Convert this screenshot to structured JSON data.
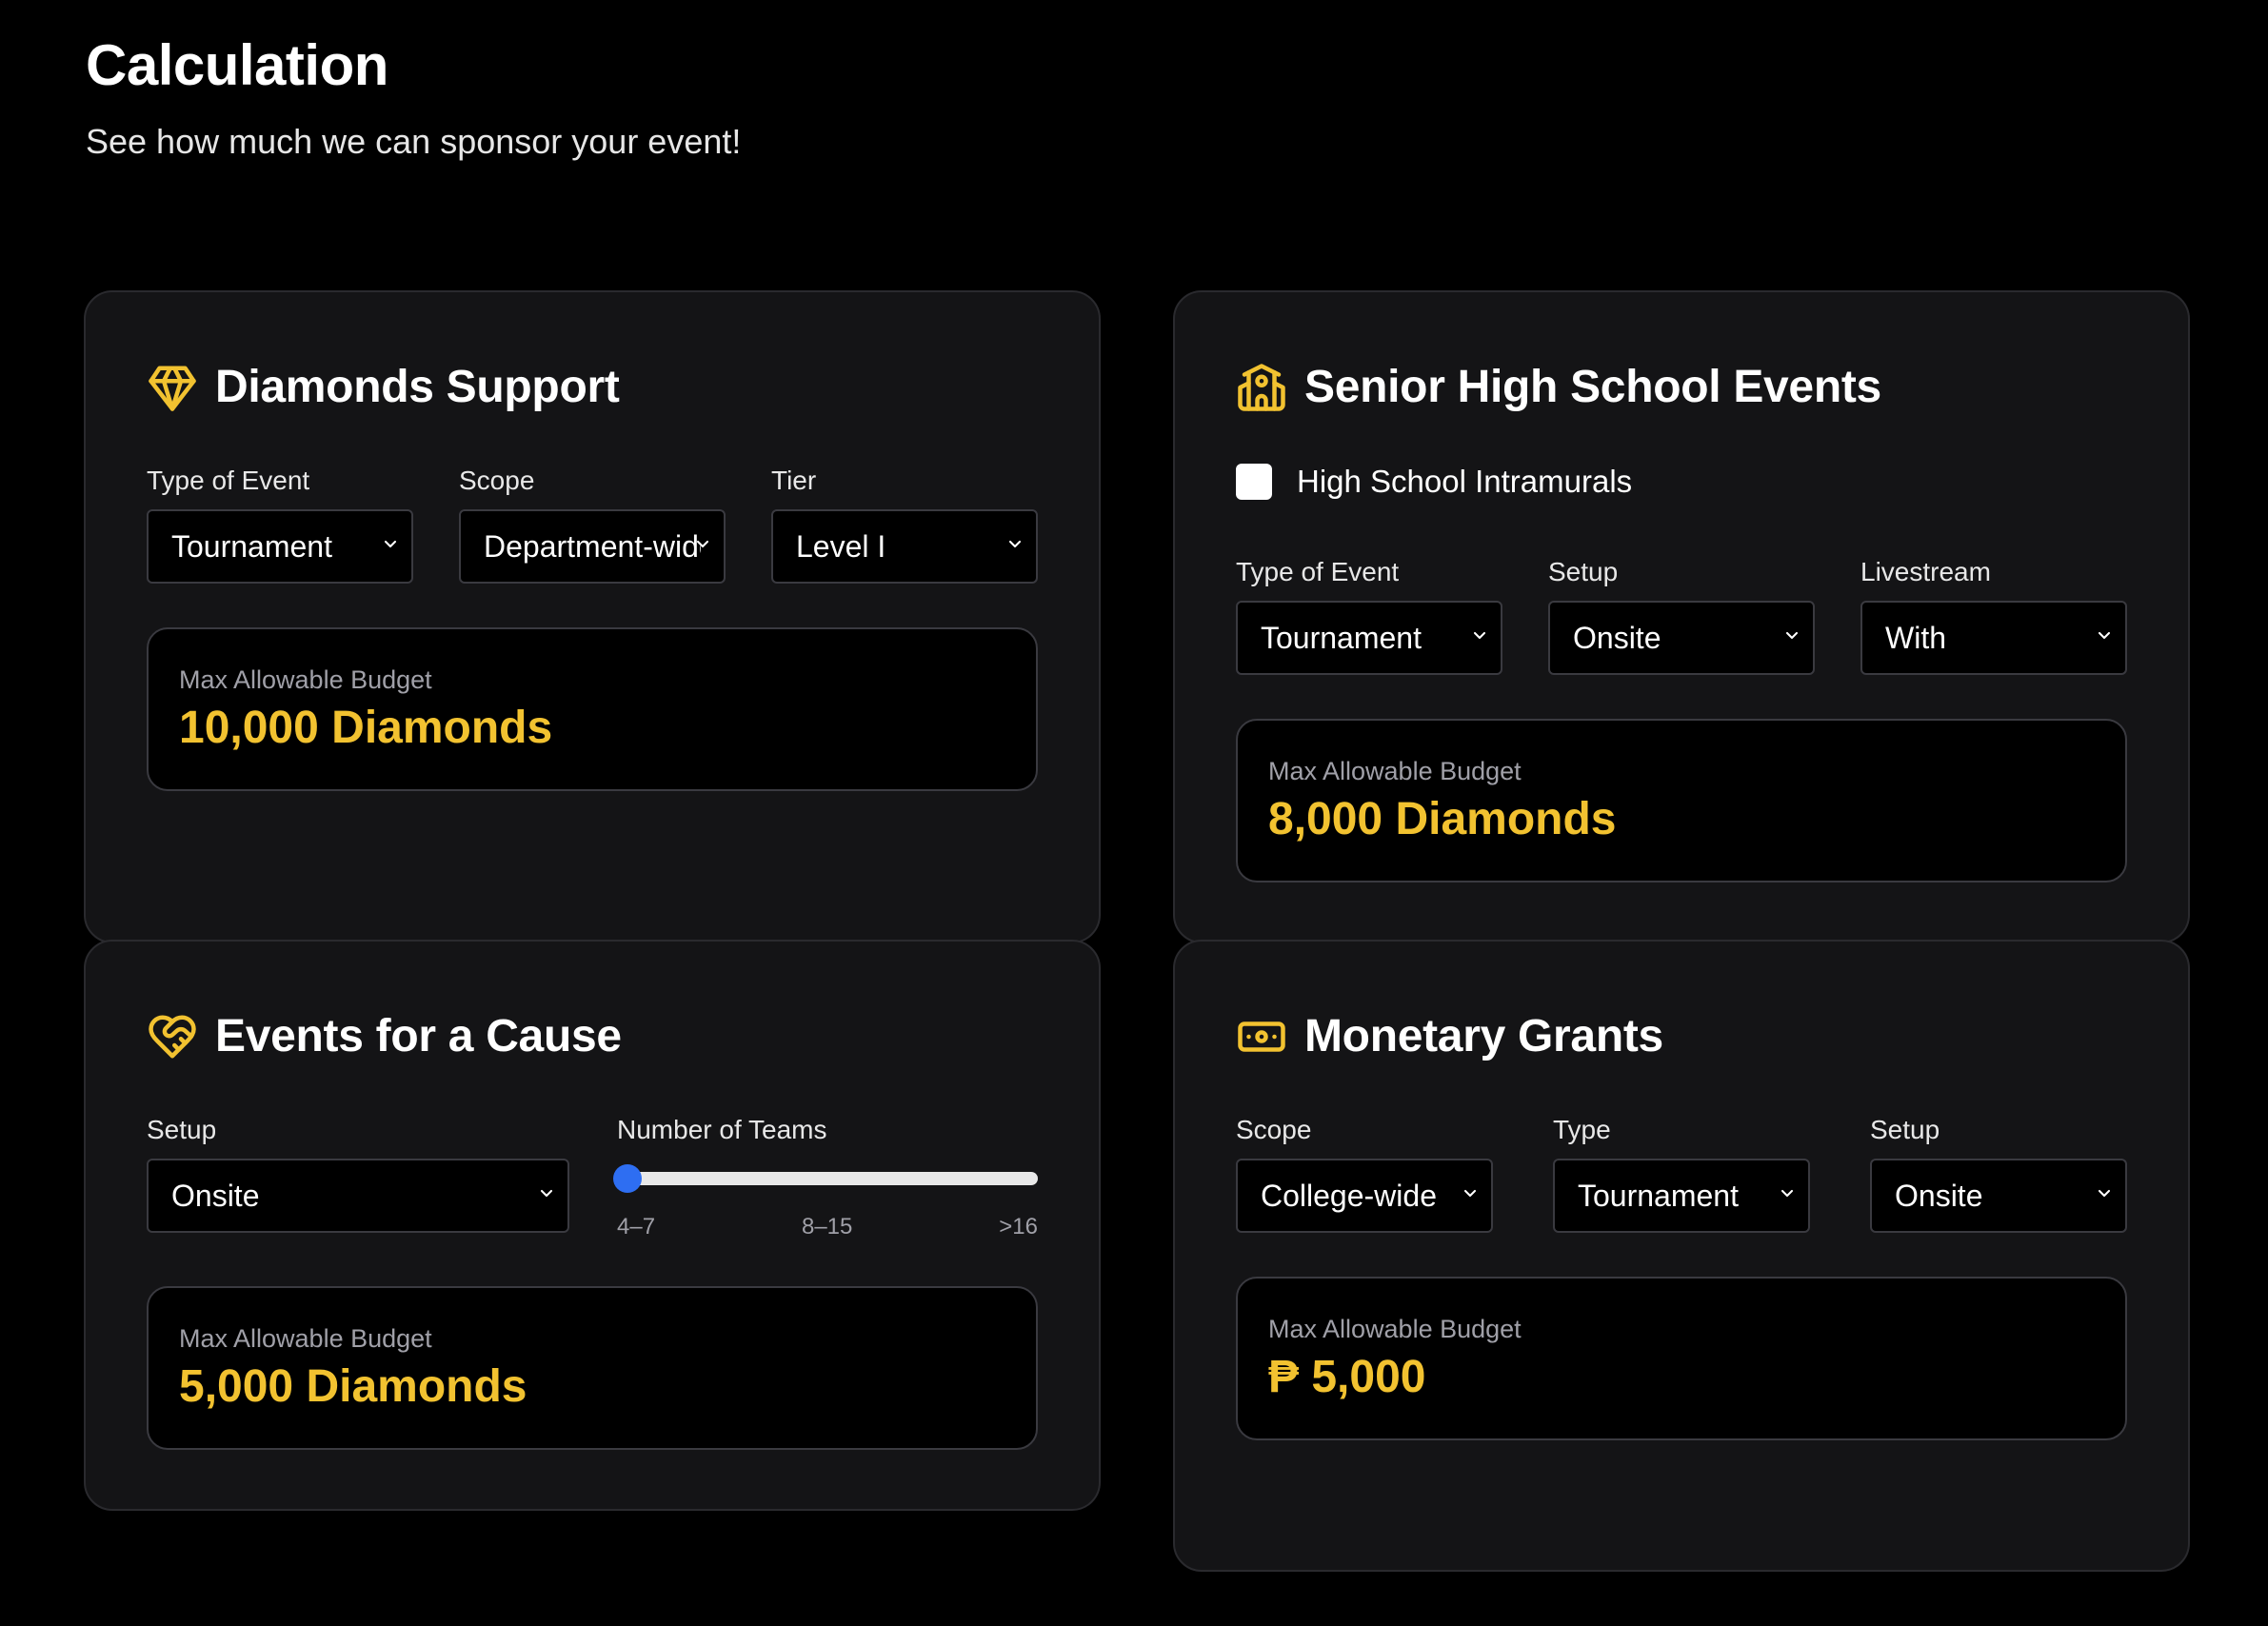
{
  "page": {
    "title": "Calculation",
    "subtitle": "See how much we can sponsor your event!"
  },
  "colors": {
    "background": "#000000",
    "card": "#141416",
    "accent": "#f2c230",
    "slider": "#2e6ef2"
  },
  "diamonds_support": {
    "icon": "diamond-icon",
    "title": "Diamonds Support",
    "type_label": "Type of Event",
    "type_value": "Tournament",
    "scope_label": "Scope",
    "scope_value": "Department-wide",
    "tier_label": "Tier",
    "tier_value": "Level I",
    "budget_label": "Max Allowable Budget",
    "budget_value": "10,000 Diamonds"
  },
  "shs_events": {
    "icon": "school-icon",
    "title": "Senior High School Events",
    "checkbox_label": "High School Intramurals",
    "checkbox_checked": false,
    "type_label": "Type of Event",
    "type_value": "Tournament",
    "setup_label": "Setup",
    "setup_value": "Onsite",
    "livestream_label": "Livestream",
    "livestream_value": "With",
    "budget_label": "Max Allowable Budget",
    "budget_value": "8,000 Diamonds"
  },
  "events_for_cause": {
    "icon": "heart-handshake-icon",
    "title": "Events for a Cause",
    "setup_label": "Setup",
    "setup_value": "Onsite",
    "teams_label": "Number of Teams",
    "teams_ticks": [
      "4–7",
      "8–15",
      ">16"
    ],
    "teams_selected_index": 0,
    "budget_label": "Max Allowable Budget",
    "budget_value": "5,000 Diamonds"
  },
  "monetary_grants": {
    "icon": "banknote-icon",
    "title": "Monetary Grants",
    "scope_label": "Scope",
    "scope_value": "College-wide",
    "type_label": "Type",
    "type_value": "Tournament",
    "setup_label": "Setup",
    "setup_value": "Onsite",
    "budget_label": "Max Allowable Budget",
    "budget_value": "₱ 5,000"
  }
}
